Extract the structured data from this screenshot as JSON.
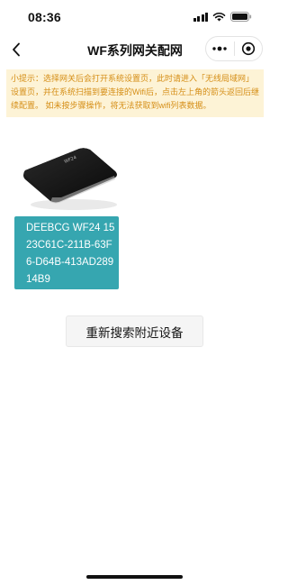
{
  "status_bar": {
    "time": "08:36"
  },
  "nav": {
    "title": "WF系列网关配网",
    "icons": {
      "back": "chevron-left-icon",
      "more": "more-dots-icon",
      "close": "target-circle-icon"
    }
  },
  "hint": {
    "text": "小提示：选择网关后会打开系统设置页，此时请进入「无线局域网」设置页，并在系统扫描到要连接的Wifi后，点击左上角的箭头返回后继续配置。 如未按步骤操作，将无法获取到wifi列表数据。"
  },
  "devices": [
    {
      "label": "DEEBCG WF24 1523C61C-211B-63F6-D64B-413AD28914B9"
    }
  ],
  "actions": {
    "rescan_label": "重新搜索附近设备"
  },
  "colors": {
    "hint_bg": "#fdf3d6",
    "hint_text": "#d58e16",
    "device_card": "#36a6b0",
    "button_bg": "#f5f5f5"
  }
}
